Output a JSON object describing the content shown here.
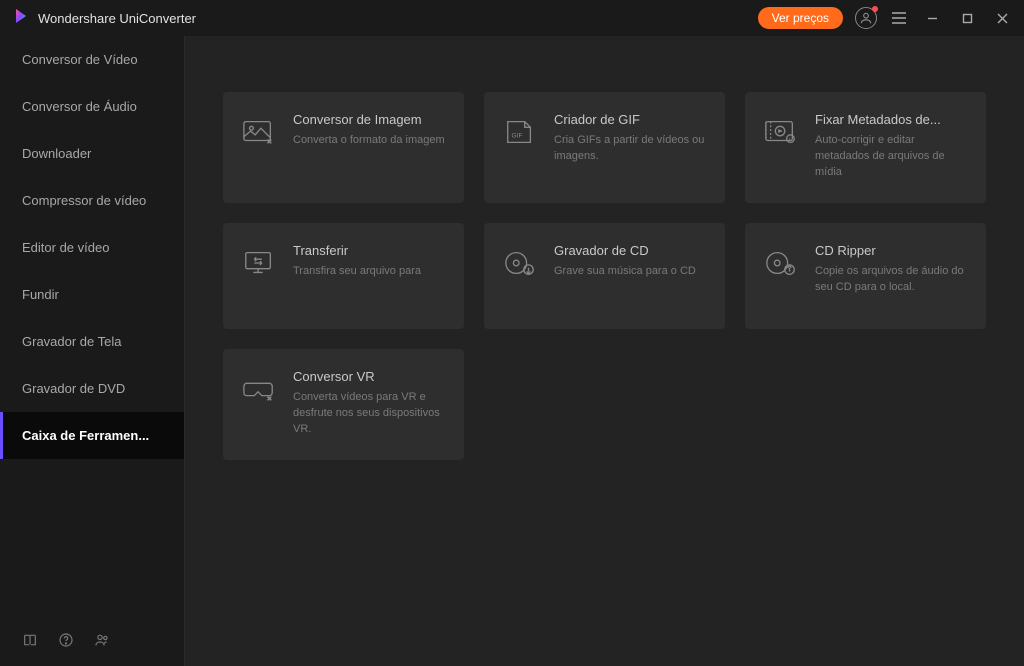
{
  "app": {
    "title": "Wondershare UniConverter",
    "price_button": "Ver preços"
  },
  "sidebar": {
    "items": [
      {
        "label": "Conversor de Vídeo",
        "active": false
      },
      {
        "label": "Conversor de Áudio",
        "active": false
      },
      {
        "label": "Downloader",
        "active": false
      },
      {
        "label": "Compressor de vídeo",
        "active": false
      },
      {
        "label": "Editor de vídeo",
        "active": false
      },
      {
        "label": "Fundir",
        "active": false
      },
      {
        "label": "Gravador de Tela",
        "active": false
      },
      {
        "label": "Gravador de DVD",
        "active": false
      },
      {
        "label": "Caixa de Ferramen...",
        "active": true
      }
    ]
  },
  "tools": [
    {
      "icon": "image-convert-icon",
      "title": "Conversor de Imagem",
      "desc": "Converta o formato da imagem"
    },
    {
      "icon": "gif-icon",
      "title": "Criador de GIF",
      "desc": "Cria GIFs a partir de vídeos ou imagens."
    },
    {
      "icon": "metadata-icon",
      "title": "Fixar Metadados de...",
      "desc": "Auto-corrigir e editar metadados de arquivos de mídia"
    },
    {
      "icon": "transfer-icon",
      "title": "Transferir",
      "desc": "Transfira seu arquivo para"
    },
    {
      "icon": "cd-burn-icon",
      "title": "Gravador de CD",
      "desc": "Grave sua música para o CD"
    },
    {
      "icon": "cd-rip-icon",
      "title": "CD Ripper",
      "desc": "Copie os arquivos de áudio do seu CD para o local."
    },
    {
      "icon": "vr-icon",
      "title": "Conversor VR",
      "desc": "Converta vídeos para VR e desfrute nos seus dispositivos VR."
    }
  ]
}
